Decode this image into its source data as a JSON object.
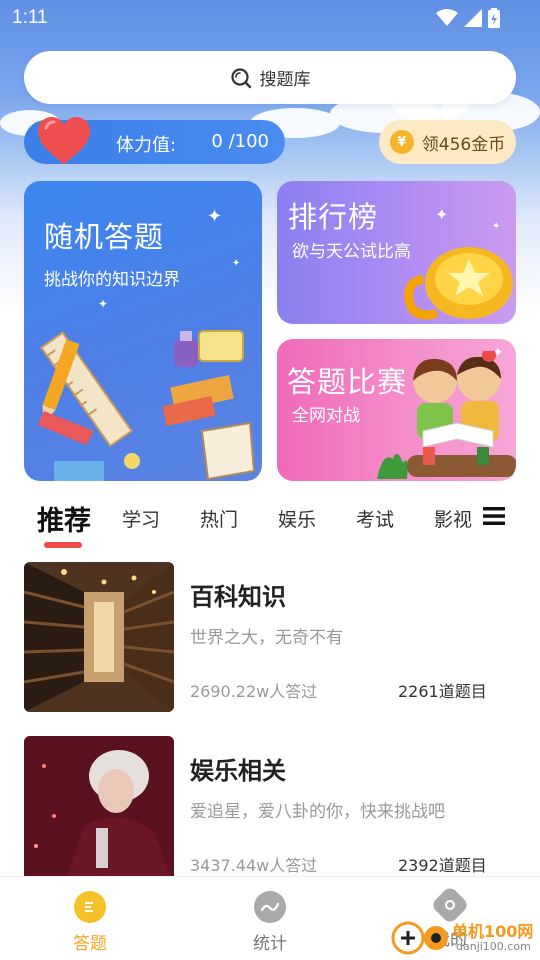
{
  "status": {
    "time": "1:11"
  },
  "search": {
    "label": "搜题库"
  },
  "stamina": {
    "label": "体力值:",
    "value": "0 /100"
  },
  "coins": {
    "coin_symbol": "¥",
    "label": "领456金币"
  },
  "cards": {
    "random": {
      "title": "随机答题",
      "subtitle": "挑战你的知识边界"
    },
    "rank": {
      "title": "排行榜",
      "subtitle": "欲与天公试比高"
    },
    "contest": {
      "title": "答题比赛",
      "subtitle": "全网对战"
    }
  },
  "tabs": [
    {
      "label": "推荐"
    },
    {
      "label": "学习"
    },
    {
      "label": "热门"
    },
    {
      "label": "娱乐"
    },
    {
      "label": "考试"
    },
    {
      "label": "影视"
    }
  ],
  "list": [
    {
      "title": "百科知识",
      "desc": "世界之大，无奇不有",
      "count": "2690.22w人答过",
      "questions": "2261道题目"
    },
    {
      "title": "娱乐相关",
      "desc": "爱追星，爱八卦的你，快来挑战吧",
      "count": "3437.44w人答过",
      "questions": "2392道题目"
    }
  ],
  "bottom_nav": [
    {
      "label": "答题",
      "icon": "quiz-icon",
      "active": true
    },
    {
      "label": "统计",
      "icon": "stats-icon",
      "active": false
    },
    {
      "label": "我的",
      "icon": "profile-icon",
      "active": false
    }
  ],
  "watermark": {
    "text": "单机100网",
    "url": "danji100.com"
  },
  "colors": {
    "accent": "#ef4b4b",
    "primary_blue": "#3a7ee8",
    "nav_active": "#f5b52a"
  }
}
